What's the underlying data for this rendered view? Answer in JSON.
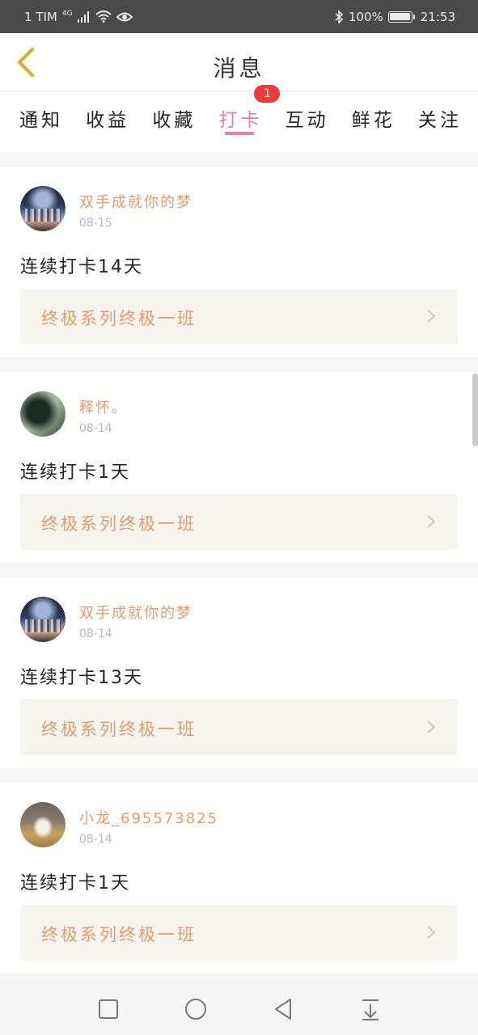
{
  "status_bar": {
    "carrier": "1 TIM",
    "network": "4G",
    "battery": "100%",
    "battery_level": 1.0,
    "time": "21:53"
  },
  "header": {
    "title": "消息",
    "back_icon": "chevron-left-icon"
  },
  "tabs": [
    {
      "label": "通知",
      "active": false
    },
    {
      "label": "收益",
      "active": false
    },
    {
      "label": "收藏",
      "active": false
    },
    {
      "label": "打卡",
      "active": true,
      "badge": "1"
    },
    {
      "label": "互动",
      "active": false
    },
    {
      "label": "鲜花",
      "active": false
    },
    {
      "label": "关注",
      "active": false
    }
  ],
  "feed": [
    {
      "username": "双手成就你的梦",
      "date": "08-15",
      "message": "连续打卡14天",
      "course": "终极系列终极一班",
      "avatar": "crowd"
    },
    {
      "username": "释怀。",
      "date": "08-14",
      "message": "连续打卡1天",
      "course": "终极系列终极一班",
      "avatar": "dark"
    },
    {
      "username": "双手成就你的梦",
      "date": "08-14",
      "message": "连续打卡13天",
      "course": "终极系列终极一班",
      "avatar": "crowd"
    },
    {
      "username": "小龙_695573825",
      "date": "08-14",
      "message": "连续打卡1天",
      "course": "终极系列终极一班",
      "avatar": "dog"
    }
  ],
  "colors": {
    "accent_tab": "#e37fa8",
    "username": "#e79b6a",
    "badge": "#ee3a3a",
    "back_icon": "#d9c84a"
  },
  "navbar": [
    "square-icon",
    "circle-icon",
    "triangle-back-icon",
    "download-icon"
  ]
}
